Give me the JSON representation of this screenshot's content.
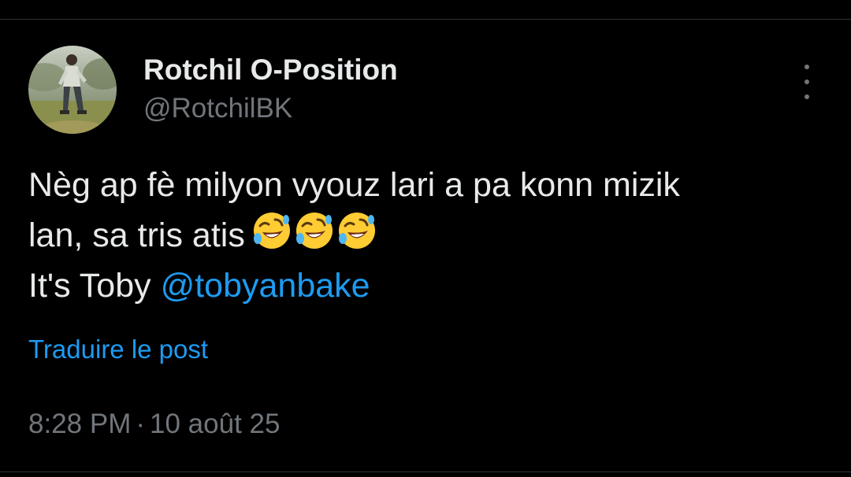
{
  "author": {
    "display_name": "Rotchil O-Position",
    "handle": "@RotchilBK",
    "avatar_icon": "profile-photo"
  },
  "tweet": {
    "line1": "Nèg ap fè milyon vyouz lari a pa konn mizik",
    "line2": "lan, sa tris atis",
    "line2_emoji": [
      "rofl-emoji",
      "rofl-emoji",
      "rofl-emoji"
    ],
    "line3_prefix": "It's Toby ",
    "mention": "@tobyanbake"
  },
  "actions": {
    "translate_label": "Traduire le post",
    "more_icon": "more-vertical-icon"
  },
  "meta": {
    "time": "8:28 PM",
    "separator": "·",
    "date": "10 août 25"
  },
  "colors": {
    "background": "#000000",
    "text_primary": "#e7e9ea",
    "text_secondary": "#71767b",
    "accent_link": "#1d9bf0",
    "divider": "#2f3336"
  }
}
